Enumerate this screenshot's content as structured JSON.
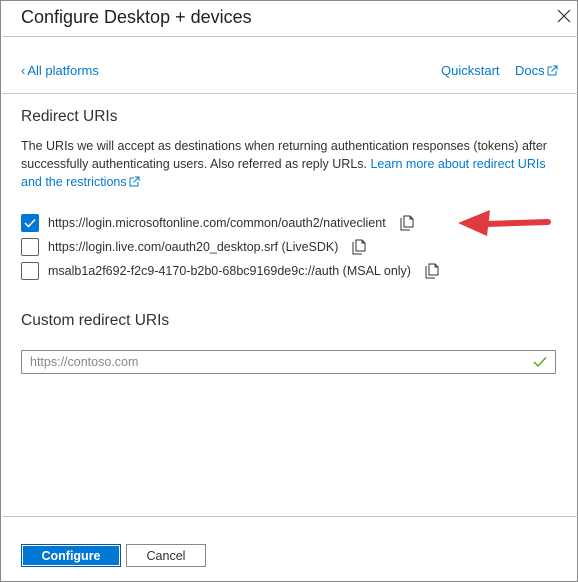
{
  "header": {
    "title": "Configure Desktop + devices",
    "close_icon": "close-icon"
  },
  "nav": {
    "back_label": "All platforms",
    "quickstart_label": "Quickstart",
    "docs_label": "Docs"
  },
  "redirect": {
    "heading": "Redirect URIs",
    "description": "The URIs we will accept as destinations when returning authentication responses (tokens) after successfully authenticating users. Also referred as reply URLs.",
    "learn_more_label": "Learn more about redirect URIs and the restrictions",
    "options": [
      {
        "label": "https://login.microsoftonline.com/common/oauth2/nativeclient",
        "checked": true
      },
      {
        "label": "https://login.live.com/oauth20_desktop.srf (LiveSDK)",
        "checked": false
      },
      {
        "label": "msalb1a2f692-f2c9-4170-b2b0-68bc9169de9c://auth (MSAL only)",
        "checked": false
      }
    ]
  },
  "custom": {
    "heading": "Custom redirect URIs",
    "placeholder": "https://contoso.com",
    "value": ""
  },
  "footer": {
    "configure_label": "Configure",
    "cancel_label": "Cancel"
  },
  "colors": {
    "accent": "#0078d4",
    "annotation_arrow": "#e0393e",
    "valid_check": "#57a300"
  }
}
